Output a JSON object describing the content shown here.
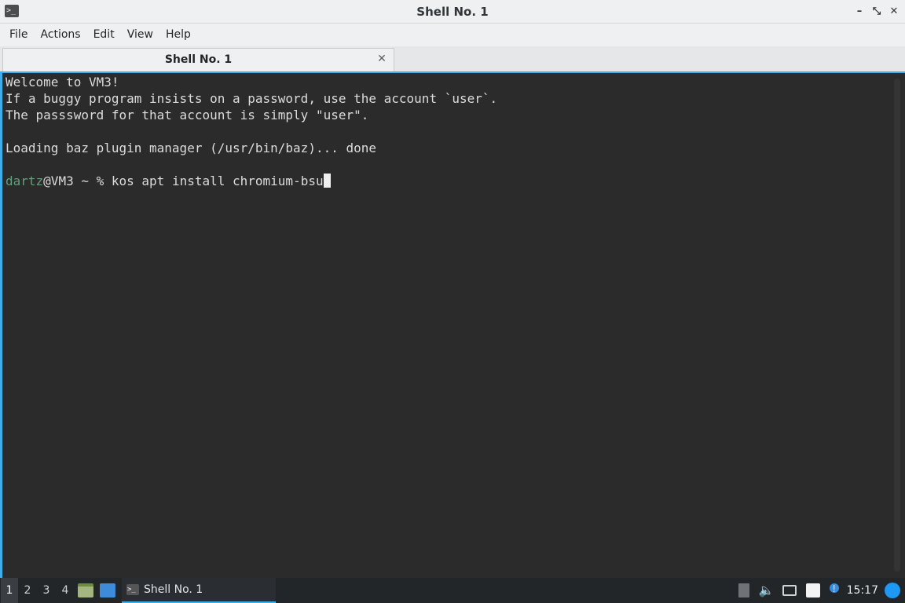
{
  "window": {
    "title": "Shell No. 1",
    "app_icon_glyph": ">_",
    "buttons": {
      "minimize": "–",
      "maximize": "⤡",
      "close": "✕"
    }
  },
  "menu": {
    "items": [
      "File",
      "Actions",
      "Edit",
      "View",
      "Help"
    ]
  },
  "tabs": [
    {
      "label": "Shell No. 1",
      "close": "✕"
    }
  ],
  "terminal": {
    "lines": [
      "Welcome to VM3!",
      "If a buggy program insists on a password, use the account `user`.",
      "The passsword for that account is simply \"user\".",
      "",
      "Loading baz plugin manager (/usr/bin/baz)... done",
      ""
    ],
    "prompt": {
      "user": "dartz",
      "host_path": "@VM3 ~ % ",
      "command": "kos apt install chromium-bsu"
    }
  },
  "taskbar": {
    "workspaces": [
      "1",
      "2",
      "3",
      "4"
    ],
    "active_workspace": "1",
    "task": {
      "label": "Shell No. 1",
      "icon_glyph": ">_"
    },
    "tray": {
      "volume_glyph": "🔈",
      "update_glyph": "!",
      "clock": "15:17"
    }
  },
  "colors": {
    "accent": "#3daee9",
    "terminal_bg": "#2b2b2b",
    "terminal_fg": "#dcdcdc",
    "prompt_user": "#5fa07e"
  }
}
